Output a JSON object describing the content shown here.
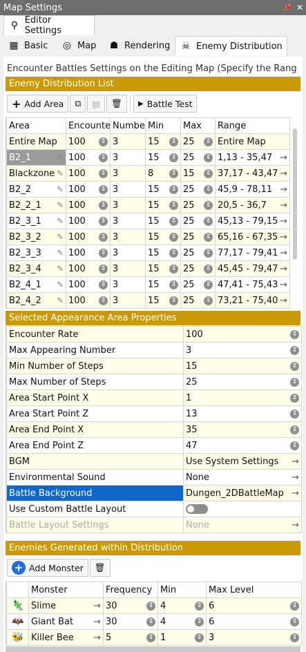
{
  "window": {
    "title": "Map Settings",
    "pin_glyph": "📌",
    "close_glyph": "✕"
  },
  "tabs": {
    "editor_settings": "Editor Settings",
    "basic": "Basic",
    "map": "Map",
    "rendering": "Rendering",
    "enemy_distribution": "Enemy Distribution"
  },
  "description": "Encounter Battles Settings on the Editing Map (Specify the Rang",
  "enemy_list": {
    "header": "Enemy Distribution List",
    "add_area": "Add Area",
    "battle_test": "Battle Test",
    "columns": [
      "Area",
      "Encounte",
      "Numbe",
      "Min",
      "Max",
      "Range"
    ],
    "rows": [
      {
        "area": "Entire Map",
        "enc": "100",
        "num": "3",
        "min": "15",
        "max": "25",
        "range": "Entire Map"
      },
      {
        "area": "B2_1",
        "enc": "100",
        "num": "3",
        "min": "15",
        "max": "25",
        "range": "1,13 - 35,47"
      },
      {
        "area": "Blackzone",
        "enc": "100",
        "num": "3",
        "min": "8",
        "max": "15",
        "range": "37,17 - 43,47"
      },
      {
        "area": "B2_2",
        "enc": "100",
        "num": "3",
        "min": "15",
        "max": "25",
        "range": "45,9 - 78,11"
      },
      {
        "area": "B2_2_1",
        "enc": "100",
        "num": "3",
        "min": "15",
        "max": "25",
        "range": "20,5 - 36,7"
      },
      {
        "area": "B2_3_1",
        "enc": "100",
        "num": "3",
        "min": "15",
        "max": "25",
        "range": "45,13 - 79,15"
      },
      {
        "area": "B2_3_2",
        "enc": "100",
        "num": "3",
        "min": "15",
        "max": "25",
        "range": "65,16 - 67,35"
      },
      {
        "area": "B2_3_3",
        "enc": "100",
        "num": "3",
        "min": "15",
        "max": "25",
        "range": "77,17 - 79,41"
      },
      {
        "area": "B2_3_4",
        "enc": "100",
        "num": "3",
        "min": "15",
        "max": "25",
        "range": "45,45 - 79,47"
      },
      {
        "area": "B2_4_1",
        "enc": "100",
        "num": "3",
        "min": "15",
        "max": "25",
        "range": "47,41 - 75,43"
      },
      {
        "area": "B2_4_2",
        "enc": "100",
        "num": "3",
        "min": "15",
        "max": "25",
        "range": "73,21 - 75,40"
      }
    ]
  },
  "properties": {
    "header": "Selected Appearance Area Properties",
    "rows": [
      {
        "label": "Encounter Rate",
        "value": "100",
        "ctl": "spin"
      },
      {
        "label": "Max Appearing Number",
        "value": "3",
        "ctl": "spin"
      },
      {
        "label": "Min Number of Steps",
        "value": "15",
        "ctl": "spin"
      },
      {
        "label": "Max Number of Steps",
        "value": "25",
        "ctl": "spin"
      },
      {
        "label": "Area Start Point X",
        "value": "1",
        "ctl": "spin"
      },
      {
        "label": "Area Start Point Z",
        "value": "13",
        "ctl": "spin"
      },
      {
        "label": "Area End Point X",
        "value": "35",
        "ctl": "spin"
      },
      {
        "label": "Area End Point Z",
        "value": "47",
        "ctl": "spin"
      },
      {
        "label": "BGM",
        "value": "Use System Settings",
        "ctl": "arrow"
      },
      {
        "label": "Environmental Sound",
        "value": "None",
        "ctl": "arrow"
      },
      {
        "label": "Battle Background",
        "value": "Dungen_2DBattleMap",
        "ctl": "arrow"
      },
      {
        "label": "Use Custom Battle Layout",
        "value": "",
        "ctl": "toggle"
      },
      {
        "label": "Battle Layout Settings",
        "value": "None",
        "ctl": "arrow"
      }
    ]
  },
  "enemies": {
    "header": "Enemies Generated within Distribution",
    "add_monster": "Add Monster",
    "columns": [
      "Monster",
      "Frequency",
      "Min",
      "Max Level"
    ],
    "rows": [
      {
        "name": "Slime",
        "freq": "30",
        "min": "4",
        "max": "6",
        "icon": "🦎"
      },
      {
        "name": "Giant Bat",
        "freq": "30",
        "min": "4",
        "max": "6",
        "icon": "🦇"
      },
      {
        "name": "Killer Bee",
        "freq": "5",
        "min": "1",
        "max": "3",
        "icon": "🐝"
      }
    ]
  },
  "colors": {
    "section": "#c99a05",
    "selected_row": "#9a9a9a",
    "highlight": "#1067c9"
  }
}
